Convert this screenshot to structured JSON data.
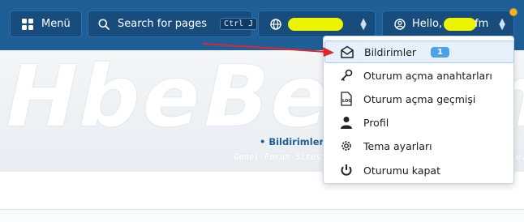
{
  "header": {
    "menu_label": "Menü",
    "search_label": "Search for pages",
    "search_shortcut": "Ctrl J",
    "greeting": "Hello,",
    "user_suffix": "fm"
  },
  "watermark": {
    "main": "HbeBeLa.net",
    "sub": "Genel Forum Sitesi / Ücretli Web Hizmetleri - www.hebele.net"
  },
  "breadcrumb": "• Bildirimleri",
  "dropdown": {
    "items": [
      {
        "label": "Bildirimler",
        "badge": "1",
        "icon": "envelope-icon"
      },
      {
        "label": "Oturum açma anahtarları",
        "icon": "key-icon"
      },
      {
        "label": "Oturum açma geçmişi",
        "icon": "log-icon"
      },
      {
        "label": "Profil",
        "icon": "person-icon"
      },
      {
        "label": "Tema ayarları",
        "icon": "gear-icon"
      },
      {
        "label": "Oturumu kapat",
        "icon": "power-icon"
      }
    ]
  },
  "colors": {
    "header_bg": "#1f5f98",
    "button_bg": "#174c7c",
    "badge": "#4aa3e6",
    "notification_dot": "#f2b322",
    "annotation_arrow": "#e0262b"
  }
}
